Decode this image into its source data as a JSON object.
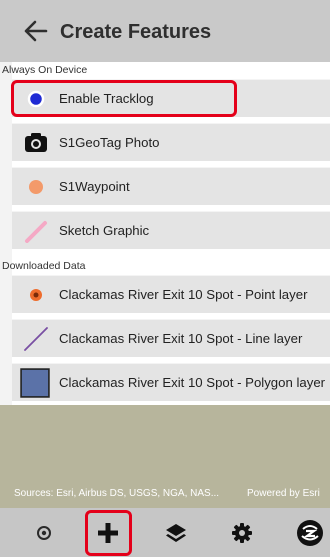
{
  "header": {
    "title": "Create Features"
  },
  "sections": {
    "always_on_device": "Always On Device",
    "downloaded_data": "Downloaded Data"
  },
  "items_device": [
    {
      "label": "Enable Tracklog",
      "icon": "blue-dot-icon"
    },
    {
      "label": "S1GeoTag Photo",
      "icon": "camera-icon"
    },
    {
      "label": "S1Waypoint",
      "icon": "orange-dot-icon"
    },
    {
      "label": "Sketch Graphic",
      "icon": "pink-line-icon"
    }
  ],
  "items_downloaded": [
    {
      "label": "Clackamas River Exit 10 Spot - Point layer",
      "icon": "orange-point-icon"
    },
    {
      "label": "Clackamas River Exit 10 Spot - Line layer",
      "icon": "purple-line-icon"
    },
    {
      "label": "Clackamas River Exit 10 Spot - Polygon layer",
      "icon": "blue-polygon-icon"
    }
  ],
  "map": {
    "attribution": "Sources: Esri, Airbus DS, USGS, NGA, NAS...",
    "powered_by": "Powered by Esri"
  },
  "toolbar": {
    "items": [
      "location-icon",
      "add-icon",
      "layers-icon",
      "settings-icon",
      "logo-icon"
    ]
  },
  "colors": {
    "highlight": "#e4001a",
    "header_bg": "#c9c9c9",
    "row_bg": "#e4e4e4"
  }
}
